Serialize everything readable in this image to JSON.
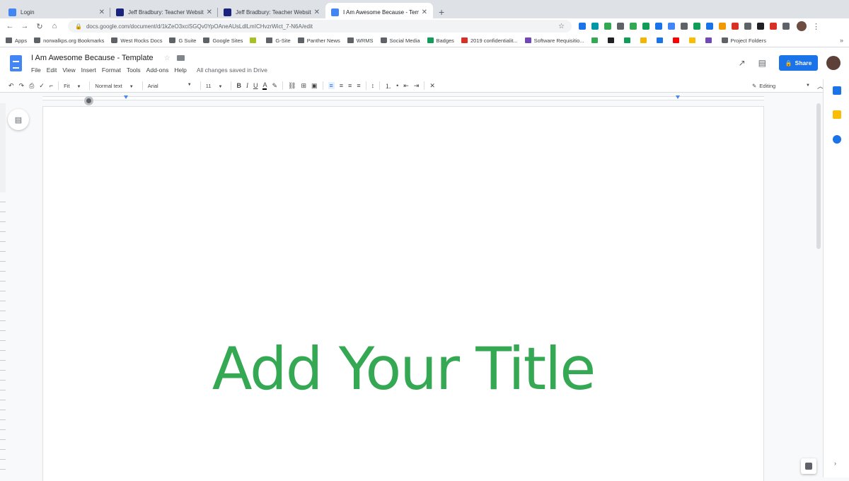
{
  "tabs": [
    {
      "title": "Login",
      "favicon_color": "#4285f4",
      "active": false
    },
    {
      "title": "Jeff Bradbury: Teacher Website",
      "favicon_color": "#1a237e",
      "active": false
    },
    {
      "title": "Jeff Bradbury: Teacher Website",
      "favicon_color": "#1a237e",
      "active": false
    },
    {
      "title": "I Am Awesome Because - Templ",
      "favicon_color": "#4285f4",
      "active": true
    }
  ],
  "url": "docs.google.com/document/d/1kZeO3xciSGQv0YpOAneAUsLdlLmICHvzrWict_7-N6A/edit",
  "bookmarks": [
    {
      "label": "Apps",
      "icon": "apps-grid-icon",
      "color": "#5f6368"
    },
    {
      "label": "norwalkps.org Bookmarks",
      "icon": "folder-icon",
      "color": "#5f6368"
    },
    {
      "label": "West Rocks Docs",
      "icon": "folder-icon",
      "color": "#5f6368"
    },
    {
      "label": "G Suite",
      "icon": "folder-icon",
      "color": "#5f6368"
    },
    {
      "label": "Google Sites",
      "icon": "folder-icon",
      "color": "#5f6368"
    },
    {
      "label": "",
      "icon": "bookmark-icon",
      "color": "#a8c023"
    },
    {
      "label": "G-Site",
      "icon": "bookmark-icon",
      "color": "#5f6368"
    },
    {
      "label": "Panther News",
      "icon": "bookmark-icon",
      "color": "#5f6368"
    },
    {
      "label": "WRMS",
      "icon": "bookmark-icon",
      "color": "#5f6368"
    },
    {
      "label": "Social Media",
      "icon": "folder-icon",
      "color": "#5f6368"
    },
    {
      "label": "Badges",
      "icon": "sheets-icon",
      "color": "#0f9d58"
    },
    {
      "label": "2019 confidentialit...",
      "icon": "pdf-icon",
      "color": "#d93025"
    },
    {
      "label": "Software Requisitio...",
      "icon": "forms-icon",
      "color": "#7248b9"
    },
    {
      "label": "",
      "icon": "drive-icon",
      "color": "#34a853"
    },
    {
      "label": "",
      "icon": "chrome-icon",
      "color": "#202124"
    },
    {
      "label": "",
      "icon": "sheets-icon",
      "color": "#0f9d58"
    },
    {
      "label": "",
      "icon": "slides-icon",
      "color": "#f4b400"
    },
    {
      "label": "",
      "icon": "calendar-icon",
      "color": "#1a73e8"
    },
    {
      "label": "",
      "icon": "youtube-icon",
      "color": "#ff0000"
    },
    {
      "label": "",
      "icon": "keep-icon",
      "color": "#fbbc04"
    },
    {
      "label": "",
      "icon": "forms-icon",
      "color": "#7248b9"
    },
    {
      "label": "Project Folders",
      "icon": "folder-icon",
      "color": "#5f6368"
    }
  ],
  "bookmarks_more": "»",
  "doc": {
    "title": "I Am Awesome Because - Template",
    "menus": [
      "File",
      "Edit",
      "View",
      "Insert",
      "Format",
      "Tools",
      "Add-ons",
      "Help"
    ],
    "save_status": "All changes saved in Drive",
    "share_label": "Share"
  },
  "toolbar": {
    "zoom": "Fit",
    "style": "Normal text",
    "font": "Arial",
    "size": "11",
    "mode": "Editing",
    "text_color": "#000000"
  },
  "content": {
    "title_text": "Add Your Title",
    "title_color": "#34a853"
  },
  "side_panel": {
    "calendar_color": "#1a73e8",
    "keep_color": "#fbbc04",
    "tasks_color": "#1a73e8"
  },
  "extensions_colors": [
    "#1a73e8",
    "#0097a7",
    "#34a853",
    "#5f6368",
    "#34a853",
    "#0f9d58",
    "#1a73e8",
    "#4285f4",
    "#5f6368",
    "#0f9d58",
    "#1a73e8",
    "#f29900",
    "#d93025",
    "#5f6368",
    "#202124",
    "#d93025",
    "#5f6368"
  ]
}
